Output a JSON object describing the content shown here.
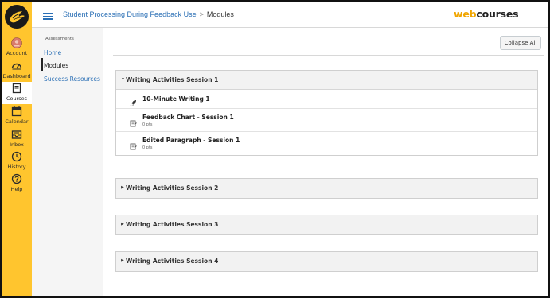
{
  "global_nav": {
    "items": [
      {
        "label": "Account",
        "icon": "account-icon"
      },
      {
        "label": "Dashboard",
        "icon": "dashboard-icon"
      },
      {
        "label": "Courses",
        "icon": "courses-icon",
        "active": true
      },
      {
        "label": "Calendar",
        "icon": "calendar-icon"
      },
      {
        "label": "Inbox",
        "icon": "inbox-icon"
      },
      {
        "label": "History",
        "icon": "history-icon"
      },
      {
        "label": "Help",
        "icon": "help-icon"
      }
    ],
    "background": "#ffc52e"
  },
  "header": {
    "course_name": "Student Processing During Feedback Use",
    "separator": ">",
    "current_page": "Modules",
    "brand_part1": "web",
    "brand_part2": "courses"
  },
  "course_nav": {
    "heading": "Assessments",
    "links": [
      {
        "label": "Home"
      },
      {
        "label": "Modules",
        "active": true
      },
      {
        "label": "Success Resources"
      }
    ]
  },
  "toolbar": {
    "collapse_all_label": "Collapse All"
  },
  "modules": [
    {
      "title": "Writing Activities Session 1",
      "expanded": true,
      "items": [
        {
          "title": "10-Minute Writing 1",
          "type": "quiz",
          "icon": "rocket-icon"
        },
        {
          "title": "Feedback Chart - Session 1",
          "points": "0 pts",
          "type": "assignment",
          "icon": "assignment-icon"
        },
        {
          "title": "Edited Paragraph - Session 1",
          "points": "0 pts",
          "type": "assignment",
          "icon": "assignment-icon"
        }
      ]
    },
    {
      "title": "Writing Activities Session 2",
      "expanded": false
    },
    {
      "title": "Writing Activities Session 3",
      "expanded": false
    },
    {
      "title": "Writing Activities Session 4",
      "expanded": false
    }
  ],
  "colors": {
    "accent_link": "#2a6fb5",
    "brand_orange": "#f0a500",
    "module_header_bg": "#f2f2f2"
  }
}
